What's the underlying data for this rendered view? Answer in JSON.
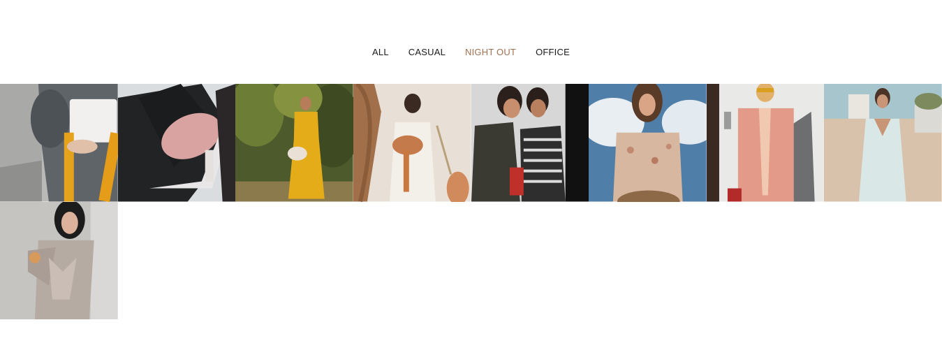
{
  "filters": [
    {
      "label": "ALL",
      "active": false
    },
    {
      "label": "CASUAL",
      "active": false
    },
    {
      "label": "NIGHT OUT",
      "active": true
    },
    {
      "label": "OFFICE",
      "active": false
    }
  ],
  "accent_color": "#a0714f",
  "gallery": {
    "items": [
      {
        "subject": "grey-dress-white-handbag"
      },
      {
        "subject": "pink-feather-sandal"
      },
      {
        "subject": "yellow-maxi-dress-garden"
      },
      {
        "subject": "lace-dress-dried-bouquet"
      },
      {
        "subject": "two-women-phone"
      },
      {
        "subject": "floral-dress-sky"
      },
      {
        "subject": "pink-blazer-sunglasses"
      },
      {
        "subject": "white-lace-dress-beach"
      },
      {
        "subject": "sequin-dress-wine-glass"
      }
    ]
  }
}
